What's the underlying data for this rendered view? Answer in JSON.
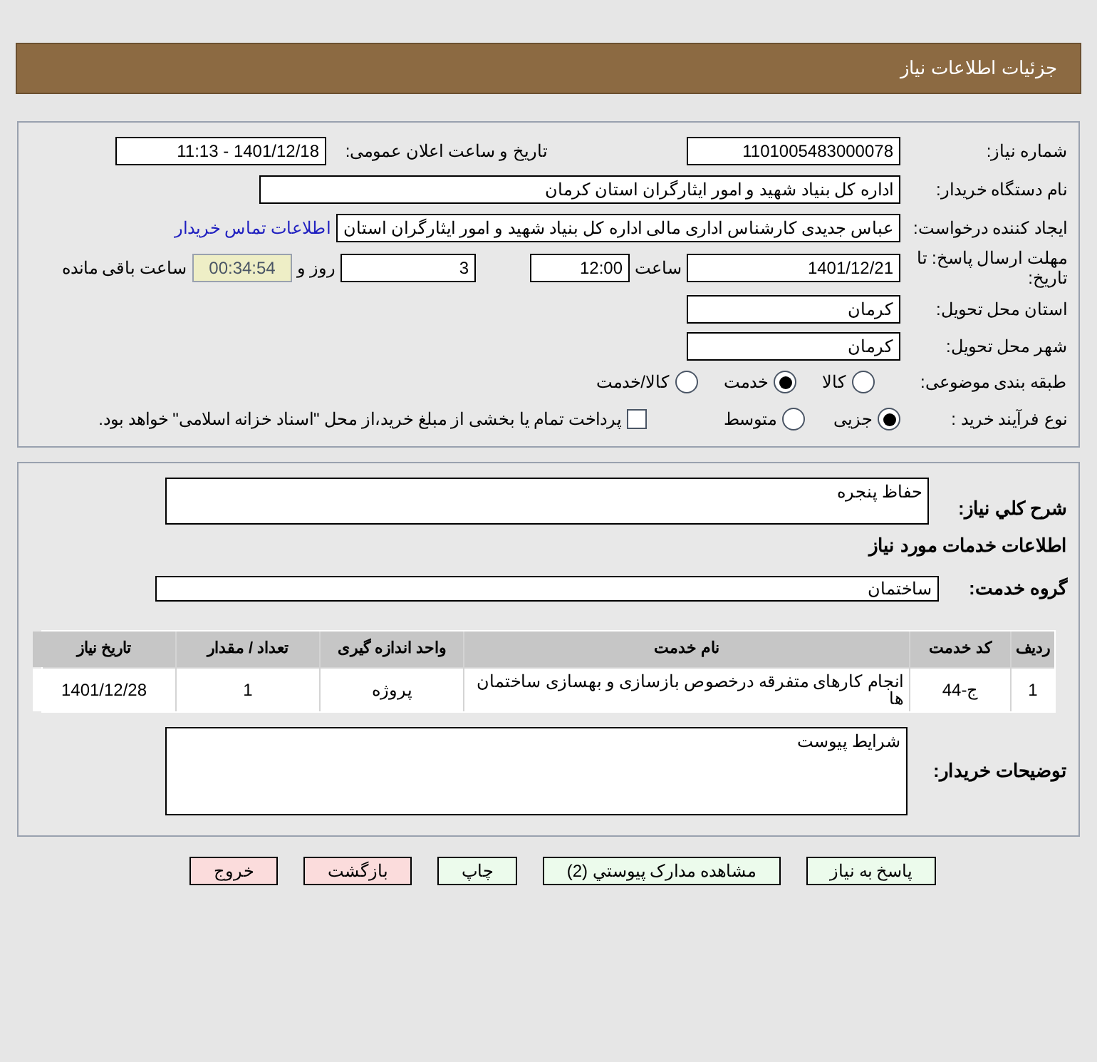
{
  "header": {
    "title": "جزئیات اطلاعات نیاز"
  },
  "need_number": {
    "label": "شماره نیاز:",
    "value": "1101005483000078"
  },
  "announce": {
    "label": "تاریخ و ساعت اعلان عمومی:",
    "value": "1401/12/18 - 11:13"
  },
  "buyer_org": {
    "label": "نام دستگاه خریدار:",
    "value": "اداره کل بنیاد شهید و امور ایثارگران استان کرمان"
  },
  "requester": {
    "label": "ایجاد کننده درخواست:",
    "value": "عباس جدیدی کارشناس اداری مالی اداره کل بنیاد شهید و امور ایثارگران استان",
    "link": "اطلاعات تماس خریدار"
  },
  "deadline": {
    "label": "مهلت ارسال پاسخ: تا تاریخ:",
    "date": "1401/12/21",
    "time_label": "ساعت",
    "time": "12:00",
    "days": "3",
    "days_label": "روز و",
    "remaining": "00:34:54",
    "remaining_label": "ساعت باقی مانده"
  },
  "province": {
    "label": "استان محل تحویل:",
    "value": "کرمان"
  },
  "city": {
    "label": "شهر محل تحویل:",
    "value": "کرمان"
  },
  "category": {
    "label": "طبقه بندی موضوعی:",
    "options": [
      {
        "label": "کالا",
        "selected": false
      },
      {
        "label": "خدمت",
        "selected": true
      },
      {
        "label": "کالا/خدمت",
        "selected": false
      }
    ]
  },
  "process": {
    "label": "نوع فرآیند خرید :",
    "options": [
      {
        "label": "جزیی",
        "selected": true
      },
      {
        "label": "متوسط",
        "selected": false
      }
    ],
    "payment": {
      "checked": false,
      "text": "پرداخت تمام یا بخشی از مبلغ خرید،از محل \"اسناد خزانه اسلامی\" خواهد بود."
    }
  },
  "description": {
    "label": "شرح کلي نیاز:",
    "value": "حفاظ پنجره"
  },
  "services_title": "اطلاعات خدمات مورد نیاز",
  "service_group": {
    "label": "گروه خدمت:",
    "value": "ساختمان"
  },
  "table": {
    "columns": [
      "ردیف",
      "کد خدمت",
      "نام خدمت",
      "واحد اندازه گیری",
      "تعداد / مقدار",
      "تاریخ نیاز"
    ],
    "rows": [
      [
        "1",
        "ج-44",
        "انجام کارهای متفرقه درخصوص بازسازی و بهسازی ساختمان ها",
        "پروژه",
        "1",
        "1401/12/28"
      ]
    ]
  },
  "buyer_notes": {
    "label": "توضیحات خریدار:",
    "value": "شرایط پیوست"
  },
  "buttons": [
    {
      "label": "پاسخ به نیاز",
      "kind": "primary"
    },
    {
      "label": "مشاهده مدارک پیوستي (2)",
      "kind": "primary"
    },
    {
      "label": "چاپ",
      "kind": "primary"
    },
    {
      "label": "بازگشت",
      "kind": "danger"
    },
    {
      "label": "خروج",
      "kind": "danger"
    }
  ]
}
